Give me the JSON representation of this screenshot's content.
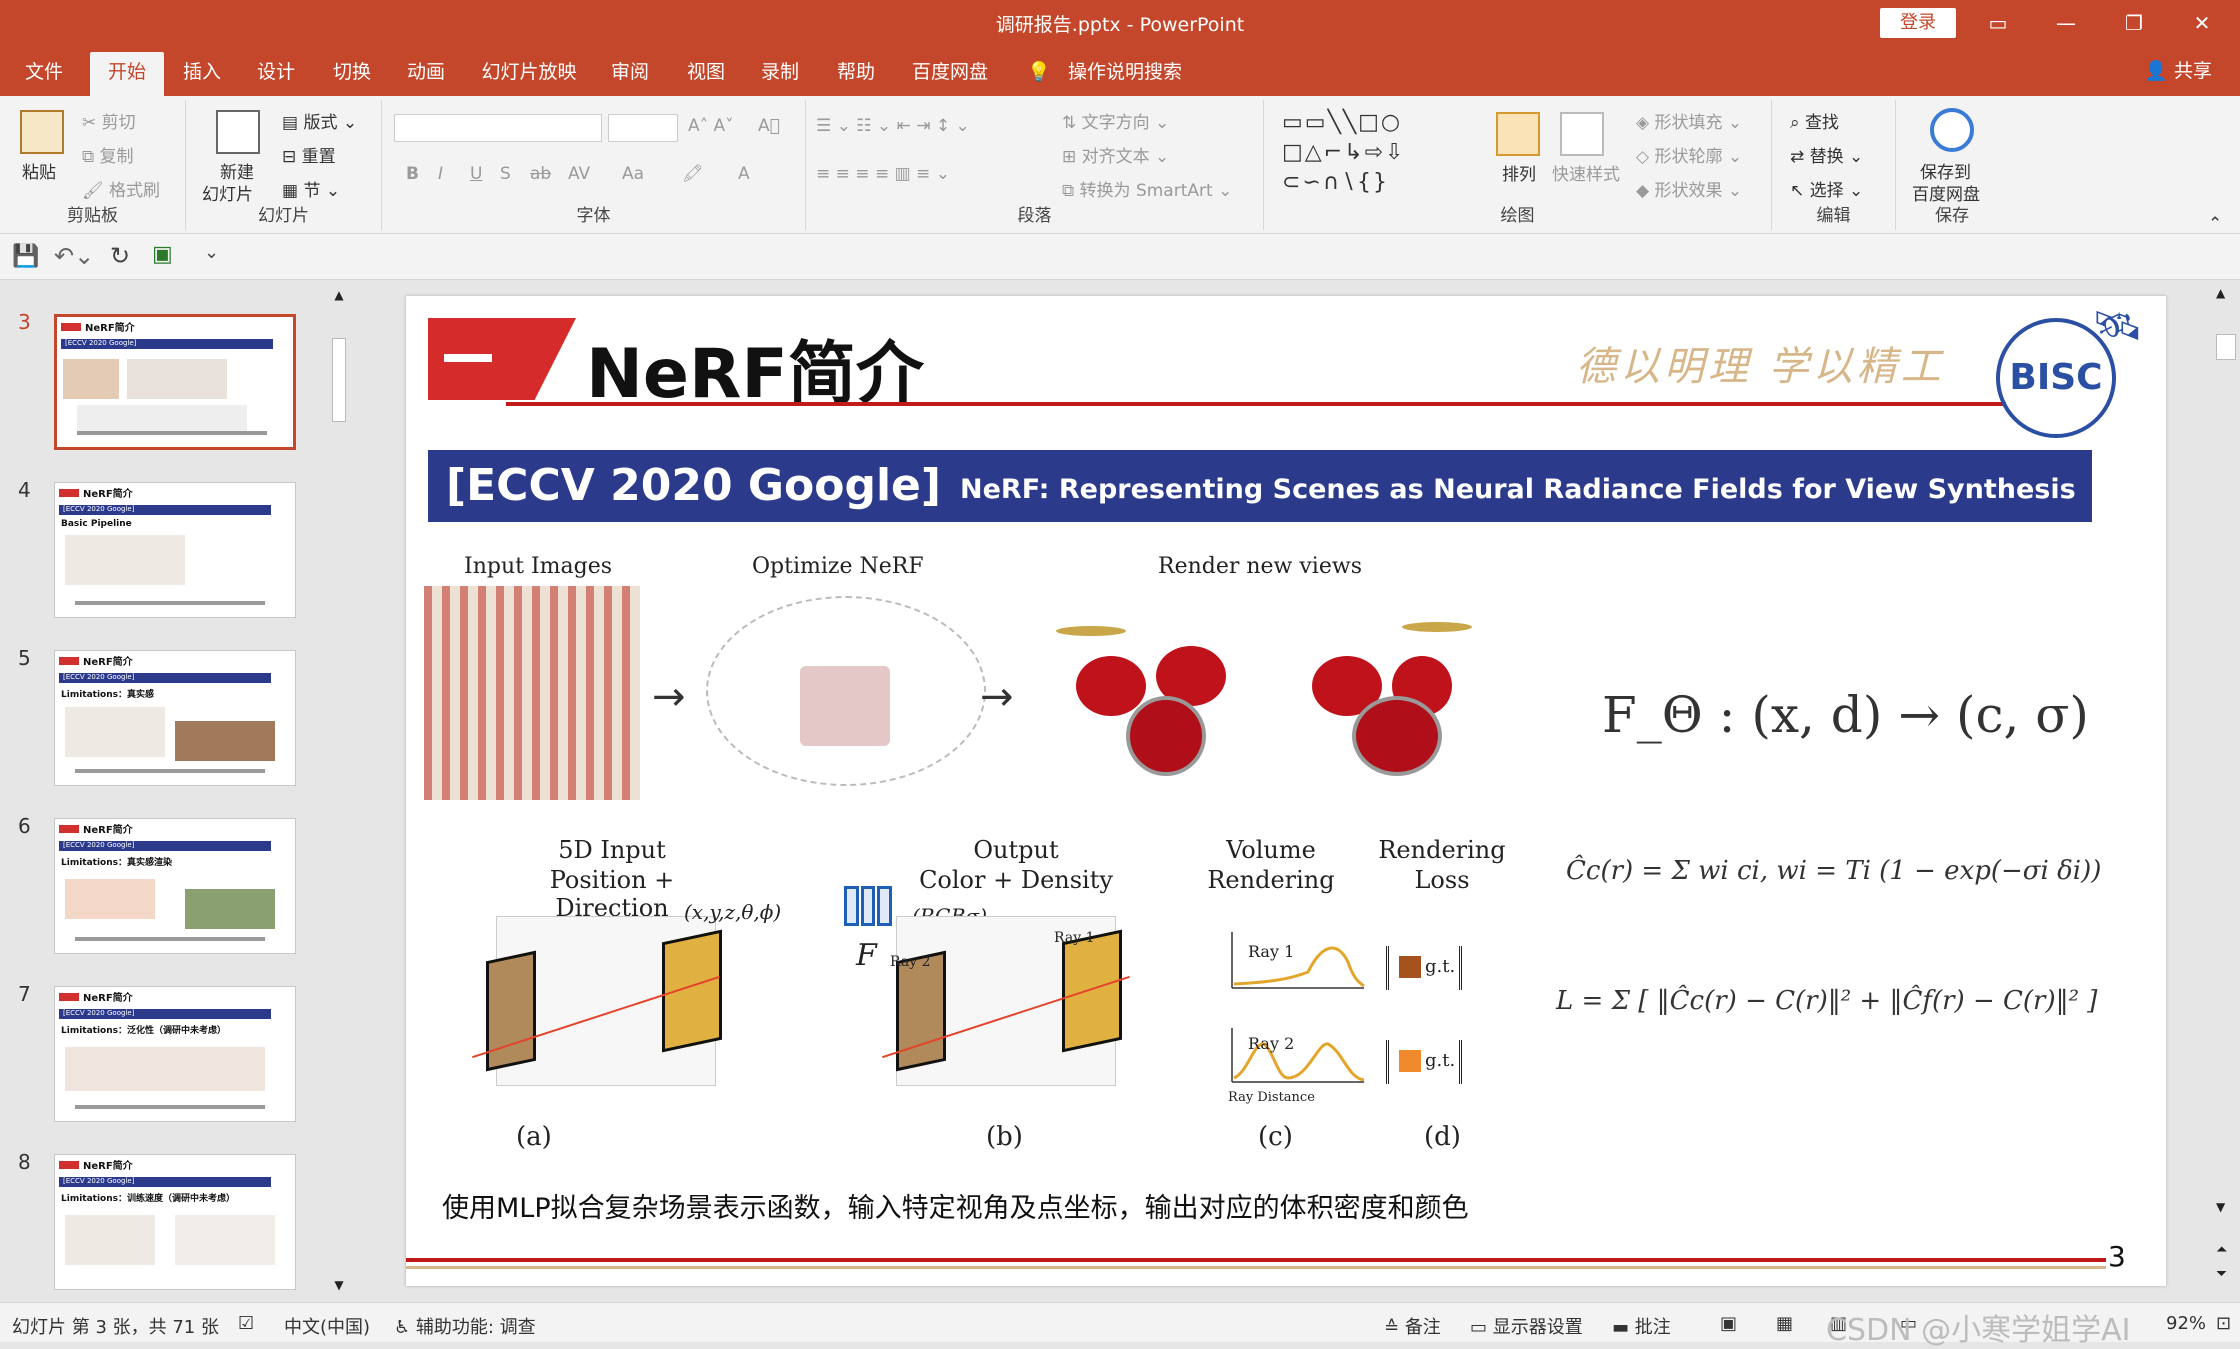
{
  "window": {
    "title": "调研报告.pptx  -  PowerPoint",
    "login": "登录"
  },
  "tabs": [
    "文件",
    "开始",
    "插入",
    "设计",
    "切换",
    "动画",
    "幻灯片放映",
    "审阅",
    "视图",
    "录制",
    "帮助",
    "百度网盘",
    "操作说明搜索"
  ],
  "share": "共享",
  "ribbon": {
    "clipboard": {
      "paste": "粘贴",
      "cut": "剪切",
      "copy": "复制",
      "format_painter": "格式刷",
      "label": "剪贴板"
    },
    "slides": {
      "new": "新建",
      "new2": "幻灯片",
      "layout": "版式",
      "reset": "重置",
      "section": "节",
      "label": "幻灯片"
    },
    "font": {
      "label": "字体",
      "bold": "B",
      "italic": "I",
      "underline": "U",
      "strike": "S",
      "abc": "ab",
      "av": "AV",
      "aa": "Aa"
    },
    "paragraph": {
      "text_direction": "文字方向",
      "align_text": "对齐文本",
      "smartart": "转换为 SmartArt",
      "label": "段落"
    },
    "drawing": {
      "arrange": "排列",
      "quick_styles": "快速样式",
      "shape_fill": "形状填充",
      "shape_outline": "形状轮廓",
      "shape_effects": "形状效果",
      "label": "绘图"
    },
    "editing": {
      "find": "查找",
      "replace": "替换",
      "select": "选择",
      "label": "编辑"
    },
    "save": {
      "line1": "保存到",
      "line2": "百度网盘",
      "label": "保存"
    }
  },
  "thumbnails": [
    {
      "num": "3",
      "title": "NeRF简介",
      "sub": "",
      "selected": true
    },
    {
      "num": "4",
      "title": "NeRF简介",
      "sub": "Basic Pipeline",
      "selected": false
    },
    {
      "num": "5",
      "title": "NeRF简介",
      "sub": "Limitations：真实感",
      "selected": false
    },
    {
      "num": "6",
      "title": "NeRF简介",
      "sub": "Limitations：真实感渲染",
      "selected": false
    },
    {
      "num": "7",
      "title": "NeRF简介",
      "sub": "Limitations：泛化性（调研中未考虑）",
      "selected": false
    },
    {
      "num": "8",
      "title": "NeRF简介",
      "sub": "Limitations：训练速度（调研中未考虑）",
      "selected": false
    }
  ],
  "slide": {
    "section_title": "NeRF简介",
    "motto": "德以明理  学以精工",
    "logo": "BISC",
    "banner_left": "[ECCV 2020 Google]",
    "banner_right": "NeRF: Representing Scenes as Neural Radiance Fields for View Synthesis",
    "fig_top": {
      "input": "Input Images",
      "optimize": "Optimize NeRF",
      "render": "Render new views"
    },
    "formula_main": "F_Θ : (x, d) → (c, σ)",
    "fig_bottom": {
      "input1": "5D Input",
      "input2": "Position + Direction",
      "output1": "Output",
      "output2": "Color + Density",
      "vol1": "Volume",
      "vol2": "Rendering",
      "loss1": "Rendering",
      "loss2": "Loss",
      "xyz": "(x,y,z,θ,ϕ)",
      "rgb": "(RGBσ)",
      "ftheta": "F",
      "ray1": "Ray 1",
      "ray2": "Ray 2",
      "raydist": "Ray Distance",
      "gt": "g.t.",
      "a": "(a)",
      "b": "(b)",
      "c": "(c)",
      "d": "(d)"
    },
    "formula_render": "Ĉc(r) = Σ wi ci,   wi = Ti (1 − exp(−σi δi))",
    "formula_loss": "L = Σ [ ‖Ĉc(r) − C(r)‖² + ‖Ĉf(r) − C(r)‖² ]",
    "caption": "使用MLP拟合复杂场景表示函数，输入特定视角及点坐标，输出对应的体积密度和颜色",
    "page": "3"
  },
  "status": {
    "slide_info": "幻灯片 第 3 张，共 71 张",
    "lang": "中文(中国)",
    "accessibility": "辅助功能: 调查",
    "notes": "备注",
    "display": "显示器设置",
    "comments": "批注",
    "zoom": "92%",
    "watermark": "CSDN @小寒学姐学AI"
  },
  "colors": {
    "brand": "#c5472b",
    "banner": "#2b3a8a",
    "red": "#d62b2b"
  }
}
